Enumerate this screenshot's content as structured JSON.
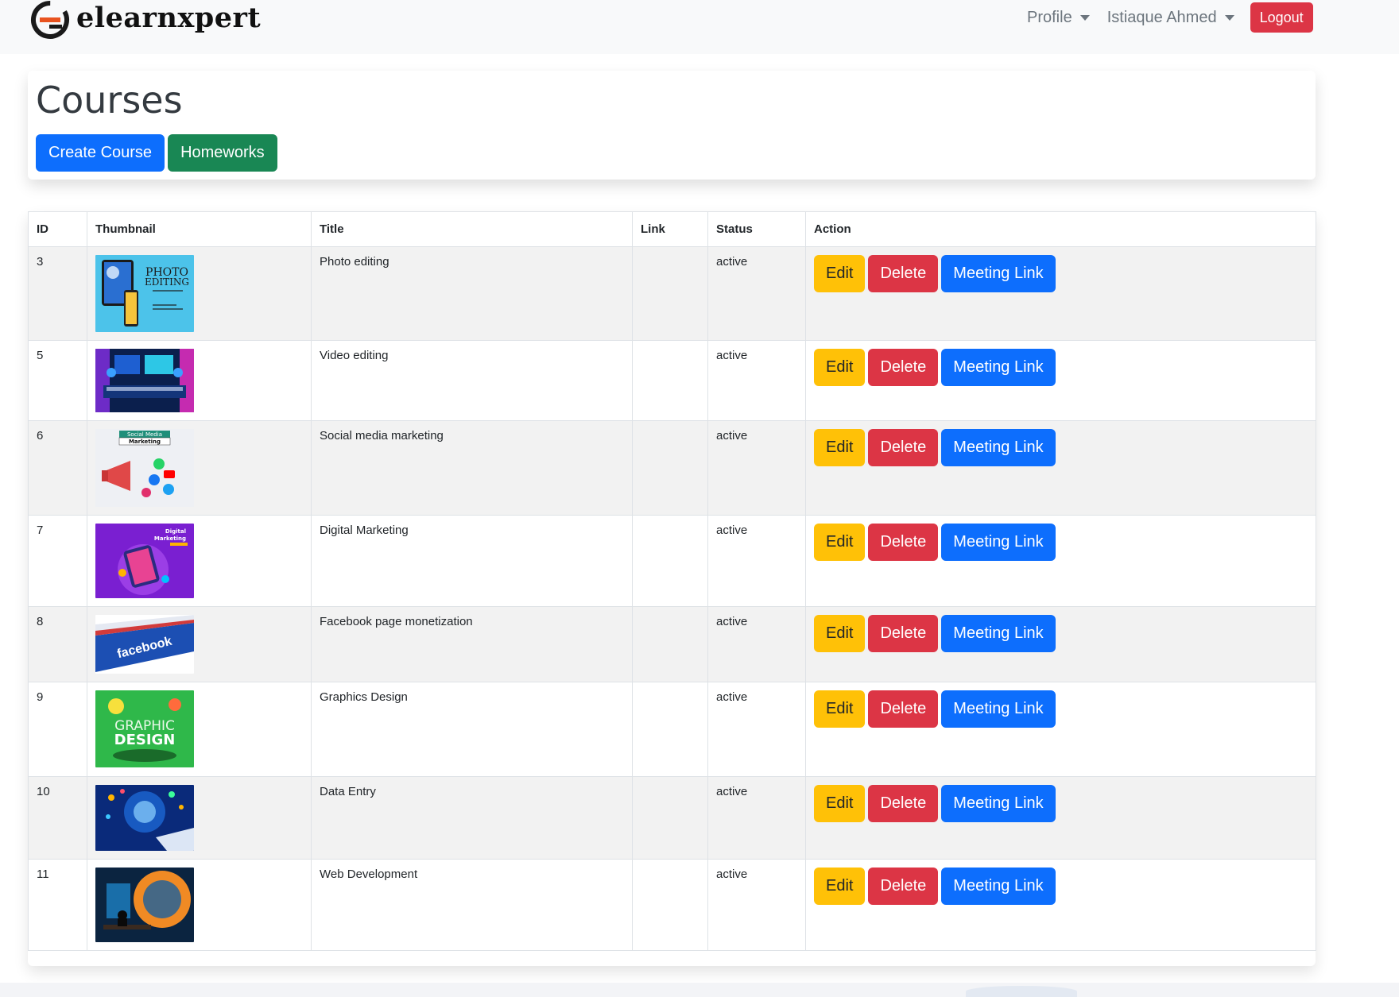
{
  "navbar": {
    "brand": "elearnxpert",
    "profile_label": "Profile",
    "user_label": "Istiaque Ahmed",
    "logout_label": "Logout"
  },
  "page": {
    "title": "Courses",
    "create_course_label": "Create Course",
    "homeworks_label": "Homeworks"
  },
  "table": {
    "headers": [
      "ID",
      "Thumbnail",
      "Title",
      "Link",
      "Status",
      "Action"
    ],
    "action_labels": {
      "edit": "Edit",
      "delete": "Delete",
      "meeting": "Meeting Link"
    },
    "rows": [
      {
        "id": "3",
        "title": "Photo editing",
        "link": "",
        "status": "active",
        "thumbnail": "photo-editing"
      },
      {
        "id": "5",
        "title": "Video editing",
        "link": "",
        "status": "active",
        "thumbnail": "video-editing"
      },
      {
        "id": "6",
        "title": "Social media marketing",
        "link": "",
        "status": "active",
        "thumbnail": "social-media-marketing"
      },
      {
        "id": "7",
        "title": "Digital Marketing",
        "link": "",
        "status": "active",
        "thumbnail": "digital-marketing"
      },
      {
        "id": "8",
        "title": "Facebook page monetization",
        "link": "",
        "status": "active",
        "thumbnail": "facebook"
      },
      {
        "id": "9",
        "title": "Graphics Design",
        "link": "",
        "status": "active",
        "thumbnail": "graphic-design"
      },
      {
        "id": "10",
        "title": "Data Entry",
        "link": "",
        "status": "active",
        "thumbnail": "data-entry"
      },
      {
        "id": "11",
        "title": "Web Development",
        "link": "",
        "status": "active",
        "thumbnail": "web-development"
      }
    ]
  },
  "thumbnail_text": {
    "photo_1": "PHOTO",
    "photo_2": "EDITING",
    "social_1": "Social Media",
    "social_2": "Marketing",
    "digital_1": "Digital",
    "digital_2": "Marketing",
    "facebook": "facebook",
    "graphic_1": "GRAPHIC",
    "graphic_2": "DESIGN"
  },
  "colors": {
    "primary": "#0d6efd",
    "success": "#198754",
    "danger": "#dc3545",
    "warning": "#ffc107",
    "brand_accent": "#e8531f"
  }
}
